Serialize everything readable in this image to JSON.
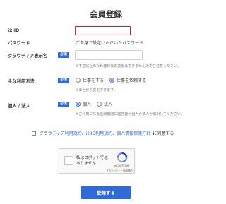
{
  "page": {
    "title": "会員登録"
  },
  "form": {
    "i2i_id": {
      "label": "i2iID",
      "value": ""
    },
    "password": {
      "label": "パスワード",
      "text": "ご自身で設定いただいたパスワード"
    },
    "display_name": {
      "label": "クラウディア表示名",
      "badge": "必須",
      "value": "",
      "note": "※不正防止のため登録後の変更はできませんのでご注意ください。"
    },
    "usage": {
      "label": "主な利用方法",
      "badge": "必須",
      "options": [
        "仕事をする",
        "仕事を依頼する"
      ],
      "selected": "仕事を依頼する",
      "note": "※あとから変更できます。"
    },
    "entity": {
      "label": "個人 / 法人",
      "badge": "必須",
      "options": [
        "個人",
        "法人"
      ],
      "selected": "個人",
      "note": "※ご利用になる金融機関口座名義が個人か法人か選択してください。"
    },
    "agreement": {
      "checked": false,
      "link1": "クラウディア利用規約",
      "sep1": "、",
      "link2": "i2iID利用規約",
      "sep2": "、",
      "link3": "個人情報保護方針",
      "tail": "に同意する"
    },
    "captcha": {
      "text": "私はロボットではありません",
      "brand": "reCAPTCHA",
      "terms": "プライバシー・利用規約"
    },
    "submit_label": "登録する"
  },
  "colors": {
    "accent": "#2f6bd6",
    "error": "#d21a2a"
  }
}
